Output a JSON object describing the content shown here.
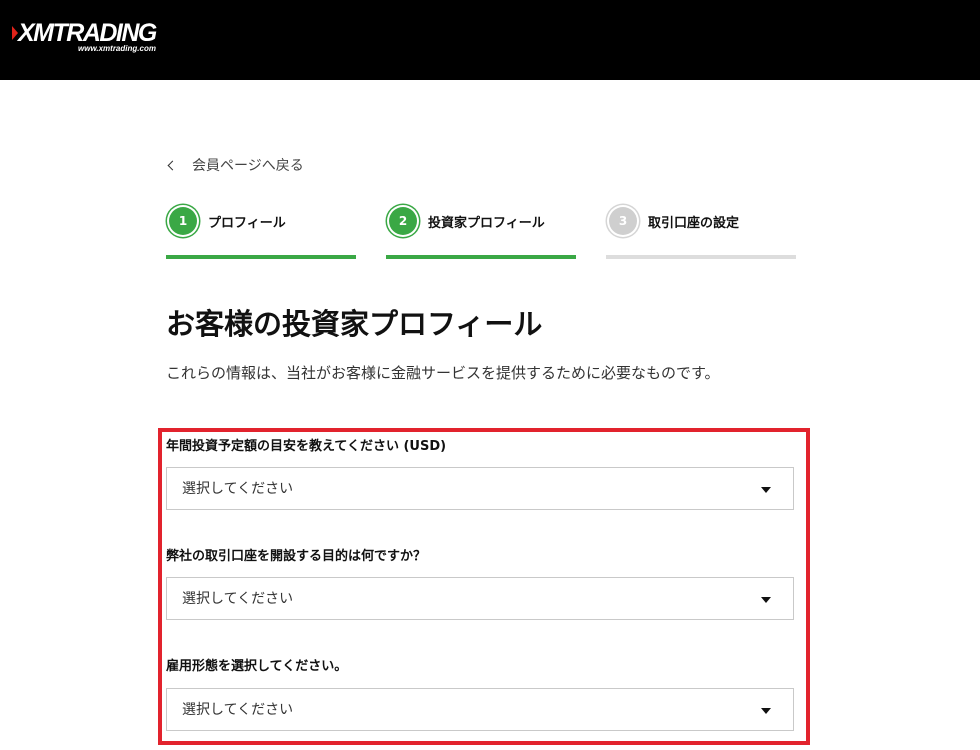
{
  "header": {
    "logo_text": "XMTRADING",
    "logo_url_text": "www.xmtrading.com",
    "background": "#000000",
    "logo_accent": "#e2231a"
  },
  "back_link": {
    "label": "会員ページへ戻る",
    "icon": "chevron-left-icon"
  },
  "steps": [
    {
      "number": "1",
      "label": "プロフィール",
      "state": "complete"
    },
    {
      "number": "2",
      "label": "投資家プロフィール",
      "state": "active"
    },
    {
      "number": "3",
      "label": "取引口座の設定",
      "state": "inactive"
    }
  ],
  "colors": {
    "step_active": "#3aa845",
    "step_inactive": "#cfcfcf",
    "highlight_border": "#e2232d"
  },
  "main": {
    "title": "お客様の投資家プロフィール",
    "subtitle": "これらの情報は、当社がお客様に金融サービスを提供するために必要なものです。"
  },
  "fields": [
    {
      "label": "年間投資予定額の目安を教えてください (USD)",
      "value": "選択してください"
    },
    {
      "label": "弊社の取引口座を開設する目的は何ですか？",
      "value": "選択してください"
    },
    {
      "label": "雇用形態を選択してください。",
      "value": "選択してください"
    }
  ]
}
